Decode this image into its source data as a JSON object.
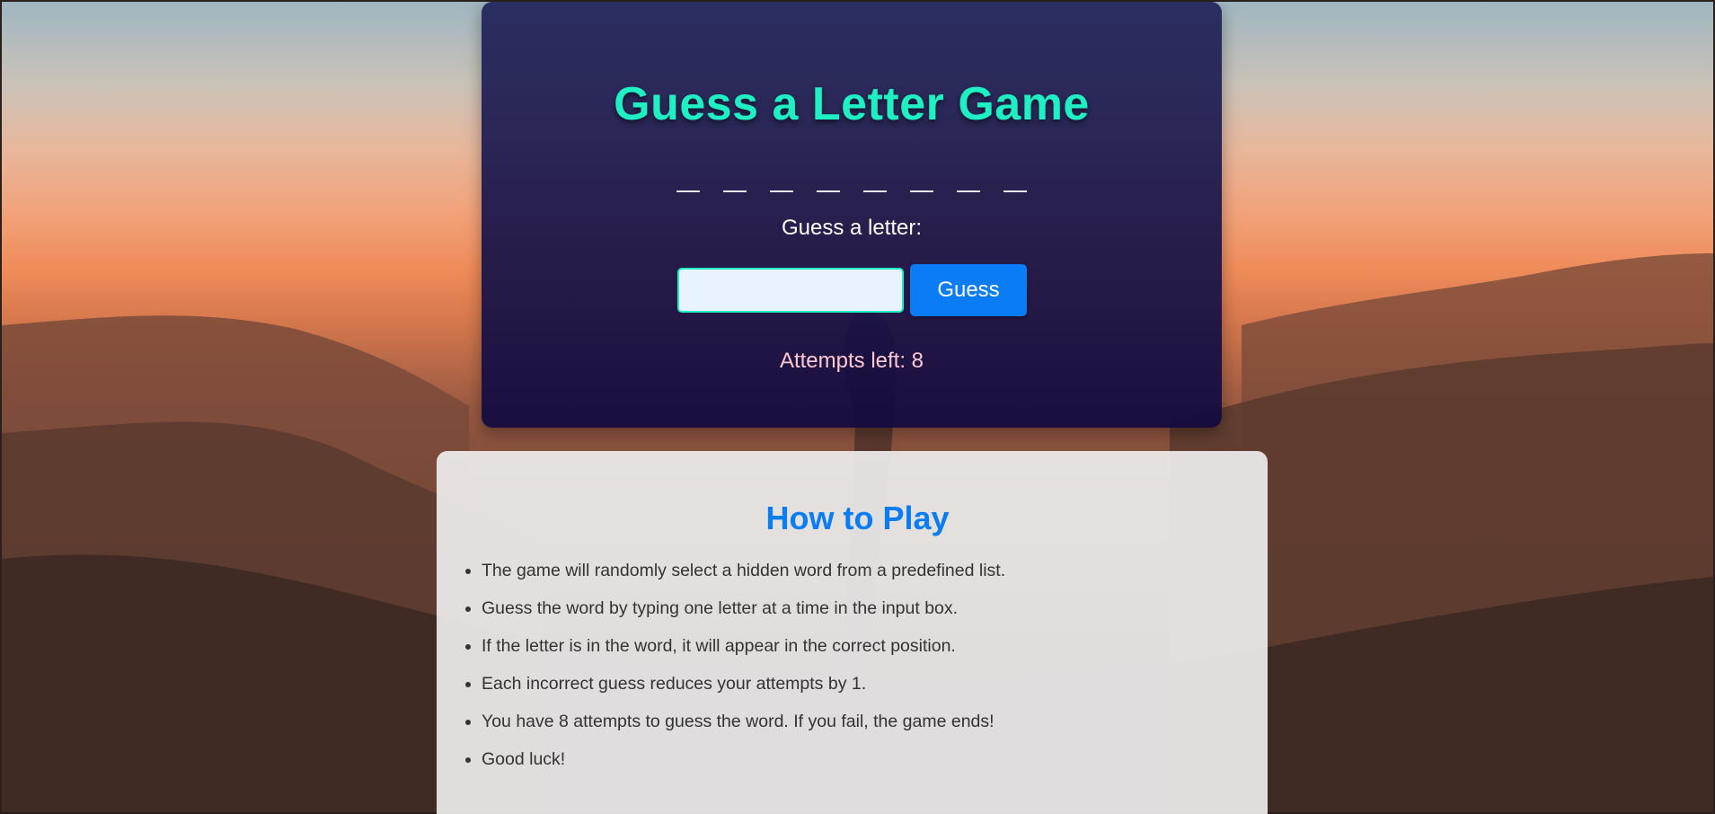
{
  "game": {
    "title": "Guess a Letter Game",
    "word_length": 8,
    "prompt": "Guess a letter:",
    "input_value": "",
    "input_placeholder": "",
    "guess_button": "Guess",
    "attempts_text": "Attempts left: 8"
  },
  "how_to_play": {
    "title": "How to Play",
    "rules": [
      "The game will randomly select a hidden word from a predefined list.",
      "Guess the word by typing one letter at a time in the input box.",
      "If the letter is in the word, it will appear in the correct position.",
      "Each incorrect guess reduces your attempts by 1.",
      "You have 8 attempts to guess the word. If you fail, the game ends!",
      "Good luck!"
    ]
  },
  "colors": {
    "title": "#1ff0c4",
    "accent": "#0a7cf5",
    "attempts": "#ffc9d2"
  }
}
